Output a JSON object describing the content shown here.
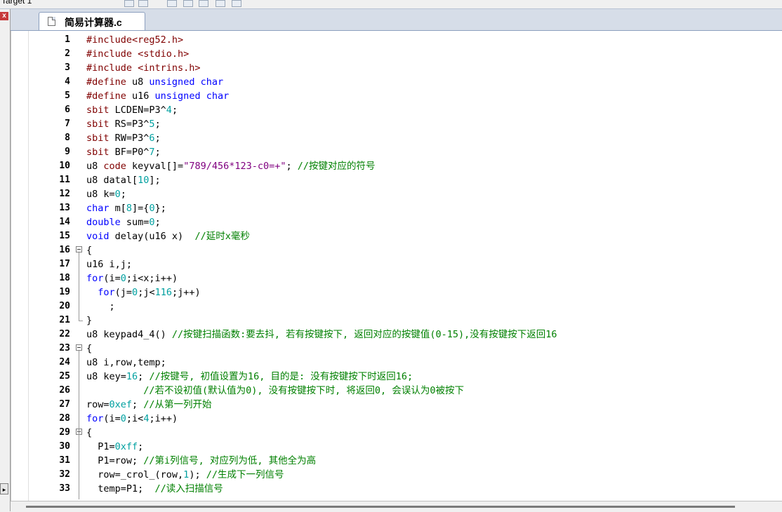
{
  "toolbar": {
    "target_label": "Target 1"
  },
  "left_panel": {
    "close_glyph": "x",
    "scroll_glyph": "▸"
  },
  "tab": {
    "filename": "简易计算器.c"
  },
  "lines": [
    {
      "n": "1",
      "t": [
        [
          "pp",
          "#include<reg52.h>"
        ]
      ]
    },
    {
      "n": "2",
      "t": [
        [
          "pp",
          "#include <stdio.h>"
        ]
      ]
    },
    {
      "n": "3",
      "t": [
        [
          "pp",
          "#include <intrins.h>"
        ]
      ]
    },
    {
      "n": "4",
      "t": [
        [
          "pp",
          "#define "
        ],
        [
          "",
          "u8 "
        ],
        [
          "k",
          "unsigned char"
        ]
      ]
    },
    {
      "n": "5",
      "t": [
        [
          "pp",
          "#define "
        ],
        [
          "",
          "u16 "
        ],
        [
          "k",
          "unsigned char"
        ]
      ]
    },
    {
      "n": "6",
      "t": [
        [
          "pp",
          "sbit "
        ],
        [
          "",
          "LCDEN=P3^"
        ],
        [
          "n",
          "4"
        ],
        [
          "",
          ";"
        ]
      ]
    },
    {
      "n": "7",
      "t": [
        [
          "pp",
          "sbit "
        ],
        [
          "",
          "RS=P3^"
        ],
        [
          "n",
          "5"
        ],
        [
          "",
          ";"
        ]
      ]
    },
    {
      "n": "8",
      "t": [
        [
          "pp",
          "sbit "
        ],
        [
          "",
          "RW=P3^"
        ],
        [
          "n",
          "6"
        ],
        [
          "",
          ";"
        ]
      ]
    },
    {
      "n": "9",
      "t": [
        [
          "pp",
          "sbit "
        ],
        [
          "",
          "BF=P0^"
        ],
        [
          "n",
          "7"
        ],
        [
          "",
          ";"
        ]
      ]
    },
    {
      "n": "10",
      "t": [
        [
          "",
          "u8 "
        ],
        [
          "pp",
          "code "
        ],
        [
          "",
          "keyval[]="
        ],
        [
          "s",
          "\"789/456*123-c0=+\""
        ],
        [
          "",
          "; "
        ],
        [
          "c",
          "//按键对应的符号"
        ]
      ]
    },
    {
      "n": "11",
      "t": [
        [
          "",
          "u8 datal["
        ],
        [
          "n",
          "10"
        ],
        [
          "",
          "];"
        ]
      ]
    },
    {
      "n": "12",
      "t": [
        [
          "",
          "u8 k="
        ],
        [
          "n",
          "0"
        ],
        [
          "",
          ";"
        ]
      ]
    },
    {
      "n": "13",
      "t": [
        [
          "k",
          "char "
        ],
        [
          "",
          "m["
        ],
        [
          "n",
          "8"
        ],
        [
          "",
          "]={"
        ],
        [
          "n",
          "0"
        ],
        [
          "",
          "};"
        ]
      ]
    },
    {
      "n": "14",
      "t": [
        [
          "k",
          "double "
        ],
        [
          "",
          "sum="
        ],
        [
          "n",
          "0"
        ],
        [
          "",
          ";"
        ]
      ]
    },
    {
      "n": "15",
      "t": [
        [
          "k",
          "void "
        ],
        [
          "",
          "delay(u16 x)  "
        ],
        [
          "c",
          "//延时x毫秒"
        ]
      ]
    },
    {
      "n": "16",
      "fold": "open",
      "t": [
        [
          "",
          "{"
        ]
      ]
    },
    {
      "n": "17",
      "t": [
        [
          "",
          "u16 i,j;"
        ]
      ]
    },
    {
      "n": "18",
      "t": [
        [
          "k",
          "for"
        ],
        [
          "",
          "(i="
        ],
        [
          "n",
          "0"
        ],
        [
          "",
          ";i<x;i++)"
        ]
      ]
    },
    {
      "n": "19",
      "t": [
        [
          "",
          "  "
        ],
        [
          "k",
          "for"
        ],
        [
          "",
          "(j="
        ],
        [
          "n",
          "0"
        ],
        [
          "",
          ";j<"
        ],
        [
          "n",
          "116"
        ],
        [
          "",
          ";j++)"
        ]
      ]
    },
    {
      "n": "20",
      "t": [
        [
          "",
          "    ;"
        ]
      ]
    },
    {
      "n": "21",
      "fold": "end",
      "t": [
        [
          "",
          "}"
        ]
      ]
    },
    {
      "n": "22",
      "t": [
        [
          "",
          "u8 keypad4_4() "
        ],
        [
          "c",
          "//按键扫描函数:要去抖, 若有按键按下, 返回对应的按键值(0-15),没有按键按下返回16"
        ]
      ]
    },
    {
      "n": "23",
      "fold": "open",
      "t": [
        [
          "",
          "{"
        ]
      ]
    },
    {
      "n": "24",
      "t": [
        [
          "",
          "u8 i,row,temp;"
        ]
      ]
    },
    {
      "n": "25",
      "t": [
        [
          "",
          "u8 key="
        ],
        [
          "n",
          "16"
        ],
        [
          "",
          "; "
        ],
        [
          "c",
          "//按键号, 初值设置为16, 目的是: 没有按键按下时返回16;"
        ]
      ]
    },
    {
      "n": "26",
      "t": [
        [
          "",
          "          "
        ],
        [
          "c",
          "//若不设初值(默认值为0), 没有按键按下时, 将返回0, 会误认为0被按下"
        ]
      ]
    },
    {
      "n": "27",
      "t": [
        [
          "",
          "row="
        ],
        [
          "n",
          "0xef"
        ],
        [
          "",
          "; "
        ],
        [
          "c",
          "//从第一列开始"
        ]
      ]
    },
    {
      "n": "28",
      "t": [
        [
          "k",
          "for"
        ],
        [
          "",
          "(i="
        ],
        [
          "n",
          "0"
        ],
        [
          "",
          ";i<"
        ],
        [
          "n",
          "4"
        ],
        [
          "",
          ";i++)"
        ]
      ]
    },
    {
      "n": "29",
      "fold": "open",
      "t": [
        [
          "",
          "{"
        ]
      ]
    },
    {
      "n": "30",
      "t": [
        [
          "",
          "  P1="
        ],
        [
          "n",
          "0xff"
        ],
        [
          "",
          ";"
        ]
      ]
    },
    {
      "n": "31",
      "t": [
        [
          "",
          "  P1=row; "
        ],
        [
          "c",
          "//第i列信号, 对应列为低, 其他全为高"
        ]
      ]
    },
    {
      "n": "32",
      "t": [
        [
          "",
          "  row=_crol_(row,"
        ],
        [
          "n",
          "1"
        ],
        [
          "",
          "); "
        ],
        [
          "c",
          "//生成下一列信号"
        ]
      ]
    },
    {
      "n": "33",
      "t": [
        [
          "",
          "  temp=P1;  "
        ],
        [
          "c",
          "//读入扫描信号"
        ]
      ]
    }
  ]
}
